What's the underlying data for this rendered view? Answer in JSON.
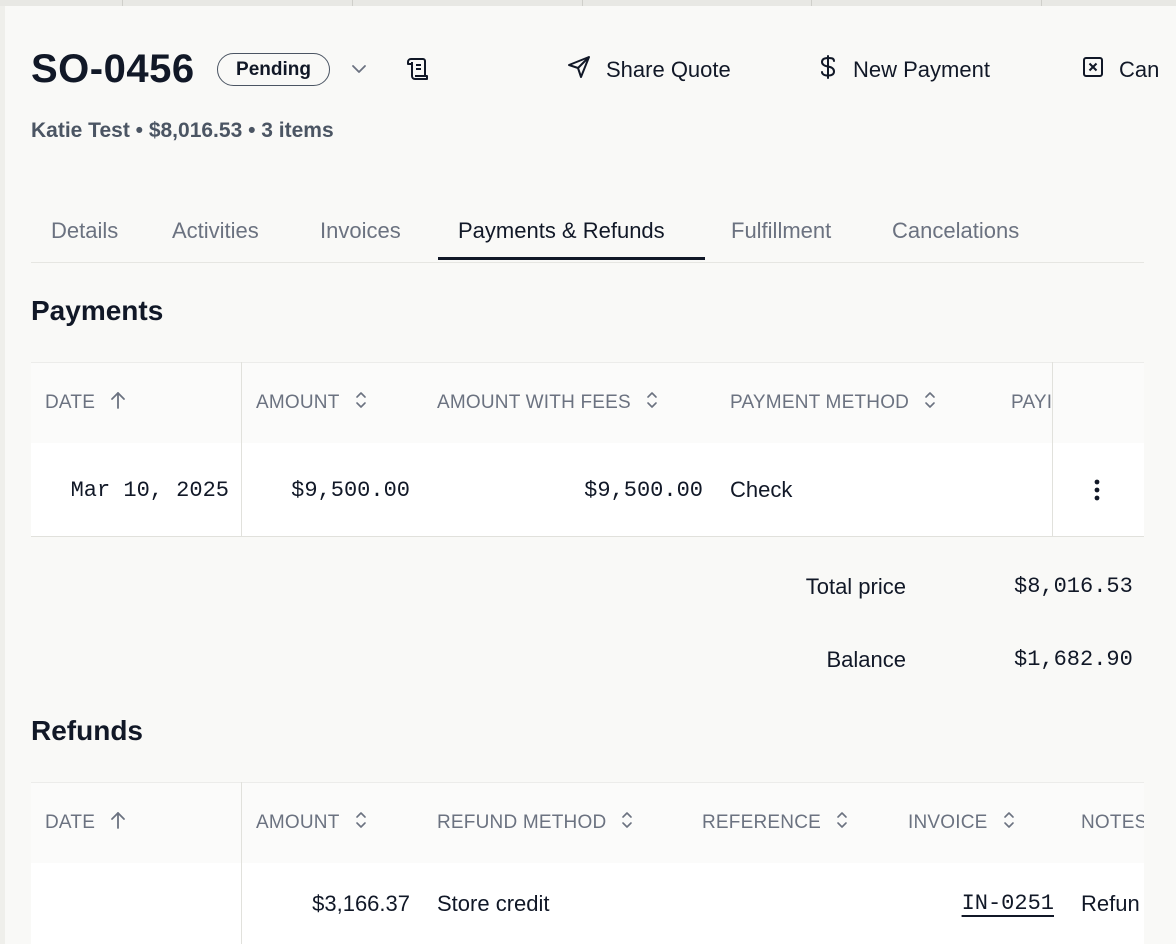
{
  "order": {
    "number": "SO-0456",
    "status": "Pending",
    "summary": "Katie Test • $8,016.53 • 3 items"
  },
  "actions": {
    "share_quote": "Share Quote",
    "new_payment": "New Payment",
    "cancel": "Can"
  },
  "tabs": [
    {
      "label": "Details"
    },
    {
      "label": "Activities"
    },
    {
      "label": "Invoices"
    },
    {
      "label": "Payments & Refunds",
      "active": true
    },
    {
      "label": "Fulfillment"
    },
    {
      "label": "Cancelations"
    }
  ],
  "payments": {
    "title": "Payments",
    "columns": [
      "DATE",
      "AMOUNT",
      "AMOUNT WITH FEES",
      "PAYMENT METHOD",
      "PAYI"
    ],
    "rows": [
      {
        "date": "Mar 10, 2025",
        "amount": "$9,500.00",
        "amount_with_fees": "$9,500.00",
        "method": "Check"
      }
    ],
    "total_price_label": "Total price",
    "total_price": "$8,016.53",
    "balance_label": "Balance",
    "balance": "$1,682.90"
  },
  "refunds": {
    "title": "Refunds",
    "columns": [
      "DATE",
      "AMOUNT",
      "REFUND METHOD",
      "REFERENCE",
      "INVOICE",
      "NOTES"
    ],
    "rows": [
      {
        "date": "",
        "amount": "$3,166.37",
        "method": "Store credit",
        "reference": "",
        "invoice": "IN-0251",
        "notes": "Refun"
      }
    ]
  },
  "icons": {
    "status_dropdown": "chevron-down-icon",
    "receipt": "receipt-icon",
    "share": "send-icon",
    "payment": "dollar-icon",
    "cancel": "close-square-icon",
    "sort_asc": "arrow-up-icon",
    "sort": "sort-icon",
    "row_menu": "more-vertical-icon"
  }
}
